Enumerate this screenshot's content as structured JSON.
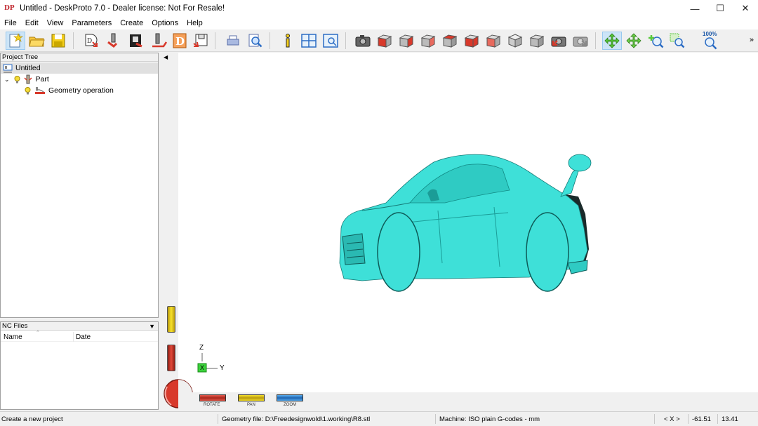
{
  "window": {
    "app_logo": "DP",
    "title": "Untitled - DeskProto 7.0 - Dealer license: Not For Resale!",
    "minimize": "—",
    "maximize": "☐",
    "close": "✕"
  },
  "menu": [
    "File",
    "Edit",
    "View",
    "Parameters",
    "Create",
    "Options",
    "Help"
  ],
  "toolbar": {
    "zoom_label": "100%",
    "overflow": "»",
    "buttons": [
      "new-project",
      "open-project",
      "save-project",
      "simulate",
      "part-parameters",
      "machine-parameters",
      "operation-parameters",
      "create-toolpath",
      "write-nc",
      "print",
      "print-preview",
      "info",
      "split-view",
      "single-view",
      "screenshot",
      "view-front",
      "view-back",
      "view-left",
      "view-right",
      "view-bottom",
      "view-top",
      "view-isometric",
      "view-iso-2",
      "snapshot-red",
      "snapshot-grey",
      "rotate-mode",
      "pan-mode",
      "zoom-mode",
      "zoom-window",
      "zoom-fit"
    ]
  },
  "project_tree": {
    "header": "Project Tree",
    "root": "Untitled",
    "part": "Part",
    "operation": "Geometry operation"
  },
  "nc_files": {
    "header": "NC Files",
    "col_name": "Name",
    "col_date": "Date"
  },
  "viewport": {
    "model_color": "#3ee0d8",
    "axis_z": "Z",
    "axis_y": "Y",
    "axis_x_marker": "X",
    "controls": {
      "rotate": "ROTATE",
      "pan": "PAN",
      "zoom": "ZOOM"
    }
  },
  "status": {
    "hint": "Create a new project",
    "geometry": "Geometry file: D:\\Freedesignwold\\1.working\\R8.stl",
    "machine": "Machine: ISO plain G-codes - mm",
    "nav": "< X >",
    "coord_x": "-61.51",
    "coord_y": "13.41"
  },
  "colors": {
    "accent": "#3ee0d8",
    "rotate": "#d8392b",
    "pan": "#e8d51a",
    "zoom": "#2f8fe0"
  }
}
